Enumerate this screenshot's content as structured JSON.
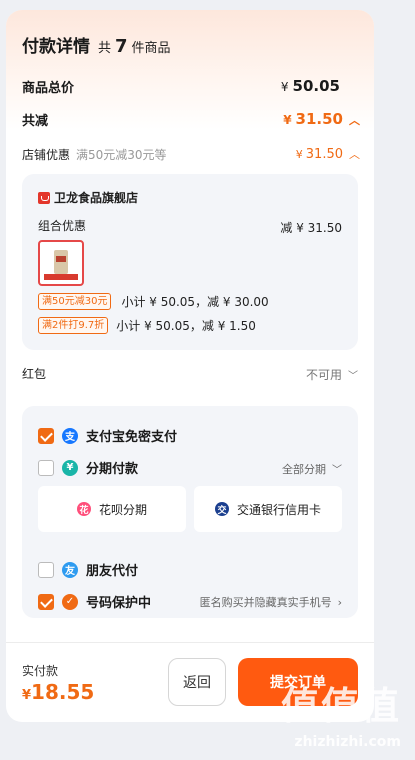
{
  "header": {
    "title": "付款详情",
    "count_pre": "共",
    "count_num": "7",
    "count_post": "件商品"
  },
  "summary": {
    "total_label": "商品总价",
    "total_currency": "¥",
    "total_value": "50.05",
    "reduce_label": "共减",
    "reduce_currency": "¥",
    "reduce_value": "31.50"
  },
  "store_discount": {
    "label": "店铺优惠",
    "note": "满50元减30元等",
    "currency": "¥",
    "value": "31.50"
  },
  "shop_card": {
    "shop_name": "卫龙食品旗舰店",
    "combo_label": "组合优惠",
    "combo_reduce": "减 ¥ 31.50",
    "promos": [
      {
        "tag": "满50元减30元",
        "text": "小计 ¥ 50.05，减 ¥ 30.00"
      },
      {
        "tag": "满2件打9.7折",
        "text": "小计 ¥ 50.05，减 ¥ 1.50"
      }
    ]
  },
  "red_packet": {
    "label": "红包",
    "status": "不可用"
  },
  "payment": {
    "alipay": {
      "label": "支付宝免密支付",
      "checked": true
    },
    "installment": {
      "label": "分期付款",
      "right": "全部分期",
      "checked": false
    },
    "sub_options": [
      {
        "label": "花呗分期"
      },
      {
        "label": "交通银行信用卡"
      }
    ],
    "friend": {
      "label": "朋友代付",
      "checked": false
    },
    "privacy": {
      "label": "号码保护中",
      "right": "匿名购买并隐藏真实手机号",
      "checked": true
    }
  },
  "footer": {
    "actual_label": "实付款",
    "actual_currency": "¥",
    "actual_value": "18.55",
    "back_label": "返回",
    "submit_label": "提交订单"
  },
  "watermark": {
    "big": "值值值",
    "small": "zhizhizhi.com"
  },
  "colors": {
    "accent": "#f06a14",
    "submit": "#ff5a10",
    "alipay_blue": "#1677ff",
    "huabei_pink": "#ff4f7b",
    "bank_blue": "#1b3f8f"
  }
}
